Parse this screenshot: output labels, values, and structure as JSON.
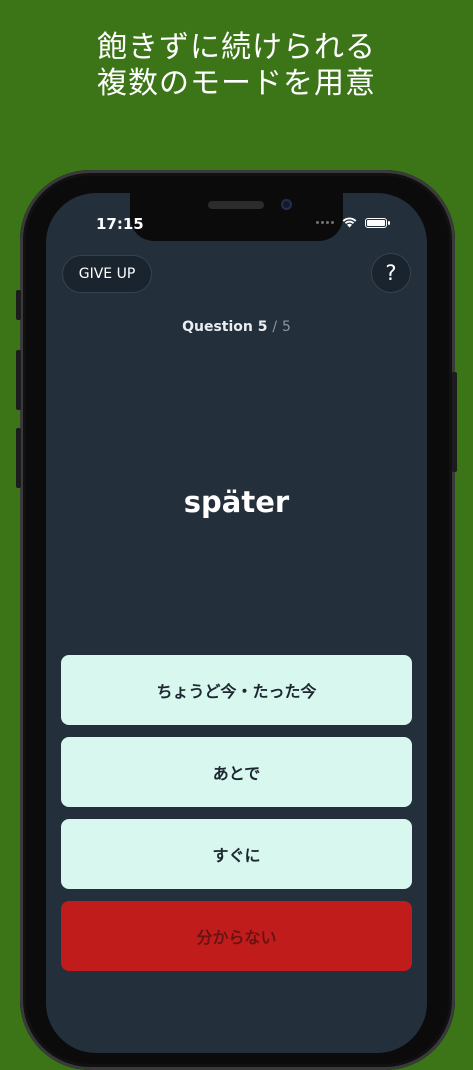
{
  "headline": {
    "line1": "飽きずに続けられる",
    "line2": "複数のモードを用意"
  },
  "status_bar": {
    "time": "17:15",
    "icons": [
      "signal-dots-icon",
      "wifi-icon",
      "battery-icon"
    ]
  },
  "toolbar": {
    "give_up_label": "GIVE UP",
    "help_label": "?"
  },
  "progress": {
    "label": "Question",
    "current": "5",
    "separator": "/",
    "total": "5"
  },
  "quiz": {
    "word": "später",
    "answers": [
      "ちょうど今・たった今",
      "あとで",
      "すぐに"
    ],
    "dont_know_label": "分からない"
  },
  "colors": {
    "background": "#3c7418",
    "screen": "#232f3b",
    "answer_bg": "#d8f7ef",
    "dont_know_bg": "#c01c1c"
  }
}
